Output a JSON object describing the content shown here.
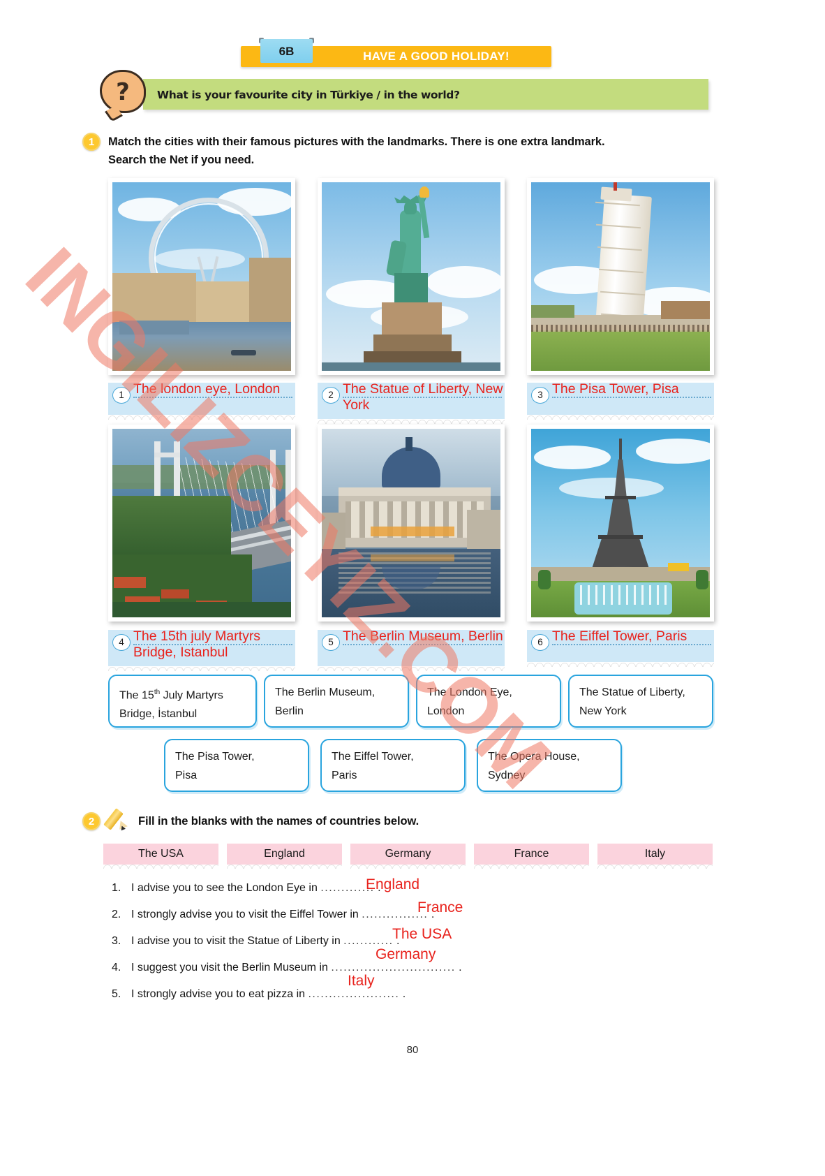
{
  "header": {
    "unit_code": "6B",
    "title": "HAVE A GOOD HOLIDAY!",
    "colors": {
      "banner": "#fcb814",
      "tab": "#8fd4f0",
      "question_strip": "#c3dc7e"
    }
  },
  "question_prompt": {
    "icon": "question-mark",
    "text": "What is your favourite city in Türkiye / in the world?"
  },
  "exercise1": {
    "number": "1",
    "instruction_line1": "Match the cities with their famous pictures with the landmarks. There is one extra landmark.",
    "instruction_line2": "Search the Net if you need.",
    "items": [
      {
        "number": "1",
        "image": "london-eye-photo",
        "answer": "The london eye, London"
      },
      {
        "number": "2",
        "image": "statue-of-liberty-photo",
        "answer": "The Statue of Liberty, New York"
      },
      {
        "number": "3",
        "image": "pisa-tower-photo",
        "answer": "The Pisa Tower, Pisa"
      },
      {
        "number": "4",
        "image": "bosphorus-bridge-photo",
        "answer": "The 15th july Martyrs Bridge, Istanbul"
      },
      {
        "number": "5",
        "image": "berlin-museum-photo",
        "answer": "The Berlin Museum, Berlin"
      },
      {
        "number": "6",
        "image": "eiffel-tower-photo",
        "answer": "The Eiffel Tower, Paris"
      }
    ],
    "word_bank_row1": [
      {
        "line1_pre": "The 15",
        "line1_sup": "th",
        "line1_post": " July Martyrs",
        "line2": "Bridge, İstanbul"
      },
      {
        "line1_pre": "The Berlin Museum,",
        "line1_sup": "",
        "line1_post": "",
        "line2": "Berlin"
      },
      {
        "line1_pre": "The London Eye,",
        "line1_sup": "",
        "line1_post": "",
        "line2": "London"
      },
      {
        "line1_pre": "The Statue of Liberty,",
        "line1_sup": "",
        "line1_post": "",
        "line2": "New York"
      }
    ],
    "word_bank_row2": [
      {
        "line1": "The Pisa Tower,",
        "line2": "Pisa"
      },
      {
        "line1": "The Eiffel Tower,",
        "line2": "Paris"
      },
      {
        "line1": "The Opera House,",
        "line2": "Sydney"
      }
    ]
  },
  "exercise2": {
    "number": "2",
    "icon": "pencil-icon",
    "instruction": "Fill in the blanks with the names of countries below.",
    "country_chips": [
      "The USA",
      "England",
      "Germany",
      "France",
      "Italy"
    ],
    "sentences": [
      {
        "index": "1.",
        "before": "I advise you to see the London Eye in",
        "answer": "England",
        "dots": ".............",
        "after": "."
      },
      {
        "index": "2.",
        "before": "I strongly advise you to visit the Eiffel Tower in",
        "answer": "France",
        "dots": "................",
        "after": "."
      },
      {
        "index": "3.",
        "before": "I advise you to visit the Statue of Liberty in",
        "answer": "The USA",
        "dots": "............",
        "after": "."
      },
      {
        "index": "4.",
        "before": "I suggest you visit the Berlin Museum in",
        "answer": "Germany",
        "dots": "..............................",
        "after": "."
      },
      {
        "index": "5.",
        "before": "I strongly advise you to eat pizza in",
        "answer": "Italy",
        "dots": "......................",
        "after": "."
      }
    ]
  },
  "watermark": {
    "text": "INGILIZCEYIZ.COM",
    "color": "#ee7864"
  },
  "page_number": "80"
}
